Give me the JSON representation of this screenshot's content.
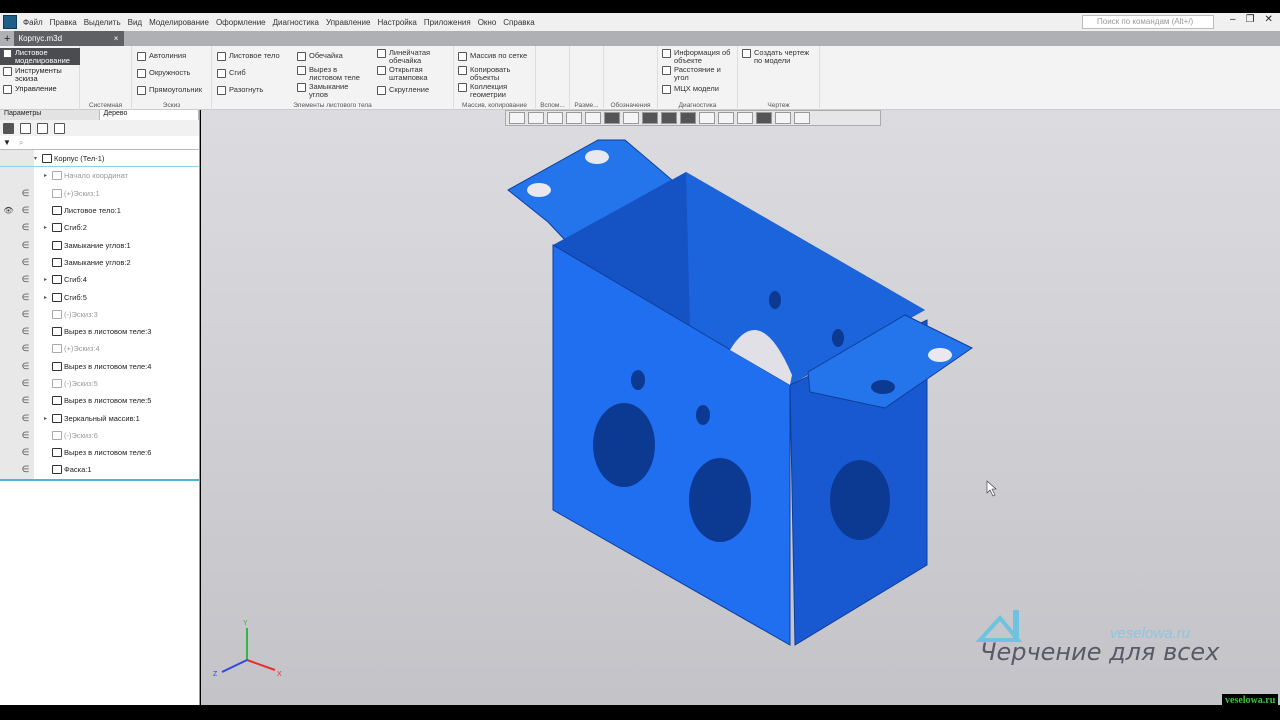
{
  "menu": [
    "Файл",
    "Правка",
    "Выделить",
    "Вид",
    "Моделирование",
    "Оформление",
    "Диагностика",
    "Управление",
    "Настройка",
    "Приложения",
    "Окно",
    "Справка"
  ],
  "search_placeholder": "Поиск по командам (Alt+/)",
  "tab": {
    "title": "Корпус.m3d",
    "close": "×",
    "new": "+"
  },
  "modes": [
    "Листовое моделирование",
    "Инструменты эскиза",
    "Управление"
  ],
  "groups": {
    "system": "Системная",
    "sketch": "Эскиз",
    "sheet": "Элементы листового тела",
    "array": "Массив, копирование",
    "aux": "Вспом...",
    "dims": "Разме...",
    "marks": "Обозначения",
    "diag": "Диагностика",
    "drawing": "Чертеж"
  },
  "sketch_cmds": [
    "Автолиния",
    "Окружность",
    "Прямоугольник"
  ],
  "sheet_cmds": [
    "Листовое тело",
    "Сгиб",
    "Разогнуть",
    "Обечайка",
    "Вырез в листовом теле",
    "Замыкание углов",
    "Линейчатая обечайка",
    "Открытая штамповка",
    "Скругление"
  ],
  "array_cmds": [
    "Массив по сетке",
    "Копировать объекты",
    "Коллекция геометрии"
  ],
  "diag_cmds": [
    "Информация об объекте",
    "Расстояние и угол",
    "МЦХ модели"
  ],
  "drawing_cmds": [
    "Создать чертеж по модели"
  ],
  "panel_tabs": [
    "Параметры",
    "Дерево"
  ],
  "tree": [
    {
      "label": "Корпус (Тел-1)",
      "dim": false,
      "root": true
    },
    {
      "label": "Начало координат",
      "dim": true
    },
    {
      "label": "(+)Эскиз:1",
      "dim": true
    },
    {
      "label": "Листовое тело:1",
      "dim": false,
      "eye": true
    },
    {
      "label": "Сгиб:2",
      "dim": false,
      "exp": true
    },
    {
      "label": "Замыкание углов:1",
      "dim": false
    },
    {
      "label": "Замыкание углов:2",
      "dim": false
    },
    {
      "label": "Сгиб:4",
      "dim": false,
      "exp": true
    },
    {
      "label": "Сгиб:5",
      "dim": false,
      "exp": true
    },
    {
      "label": "(-)Эскиз:3",
      "dim": true
    },
    {
      "label": "Вырез в листовом теле:3",
      "dim": false
    },
    {
      "label": "(+)Эскиз:4",
      "dim": true
    },
    {
      "label": "Вырез в листовом теле:4",
      "dim": false
    },
    {
      "label": "(-)Эскиз:5",
      "dim": true
    },
    {
      "label": "Вырез в листовом теле:5",
      "dim": false
    },
    {
      "label": "Зеркальный массив:1",
      "dim": false,
      "exp": true
    },
    {
      "label": "(-)Эскиз:6",
      "dim": true
    },
    {
      "label": "Вырез в листовом теле:6",
      "dim": false
    },
    {
      "label": "Фаска:1",
      "dim": false
    }
  ],
  "axes": {
    "x": "X",
    "y": "Y",
    "z": "Z"
  },
  "watermark": {
    "title": "Черчение для всех",
    "site": "veselowa.ru",
    "badge": "veselowa.ru"
  },
  "colors": {
    "model": "#1e6fe6",
    "model_dark": "#1450b8"
  }
}
